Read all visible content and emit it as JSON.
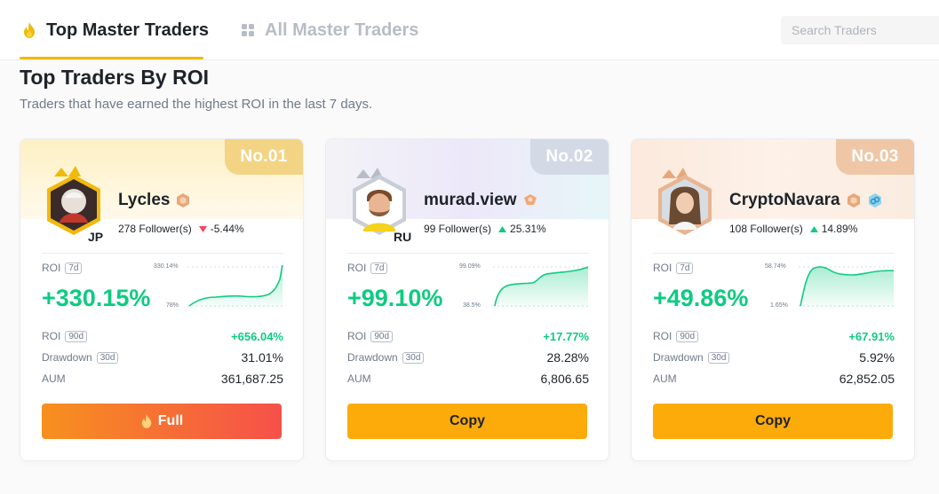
{
  "tabs": [
    {
      "label": "Top Master Traders",
      "icon": "fire-icon",
      "active": true
    },
    {
      "label": "All Master Traders",
      "icon": "grid-icon",
      "active": false
    }
  ],
  "search": {
    "placeholder": "Search Traders"
  },
  "section": {
    "title": "Top Traders By ROI",
    "subtitle": "Traders that have earned the highest ROI in the last 7 days."
  },
  "labels": {
    "roi": "ROI",
    "period_7d": "7d",
    "period_90d": "90d",
    "drawdown": "Drawdown",
    "period_30d": "30d",
    "aum": "AUM"
  },
  "traders": [
    {
      "rank": "No.01",
      "name": "Lycles",
      "country": "JP",
      "followers": "278 Follower(s)",
      "change": "-5.44%",
      "change_dir": "down",
      "roi_7d": "+330.15%",
      "spark_max": "330.14%",
      "spark_min": "78%",
      "roi_90d": "+656.04%",
      "drawdown_30d": "31.01%",
      "aum": "361,687.25",
      "button": "Full",
      "button_icon": "fire-icon",
      "theme_color": "#f0b90b"
    },
    {
      "rank": "No.02",
      "name": "murad.view",
      "country": "RU",
      "followers": "99 Follower(s)",
      "change": "25.31%",
      "change_dir": "up",
      "roi_7d": "+99.10%",
      "spark_max": "99.09%",
      "spark_min": "38.5%",
      "roi_90d": "+17.77%",
      "drawdown_30d": "28.28%",
      "aum": "6,806.65",
      "button": "Copy",
      "theme_color": "#b7bdc6"
    },
    {
      "rank": "No.03",
      "name": "CryptoNavara",
      "country": "",
      "followers": "108 Follower(s)",
      "change": "14.89%",
      "change_dir": "up",
      "roi_7d": "+49.86%",
      "spark_max": "58.74%",
      "spark_min": "1.65%",
      "roi_90d": "+67.91%",
      "drawdown_30d": "5.92%",
      "aum": "62,852.05",
      "button": "Copy",
      "theme_color": "#e2a06f"
    }
  ],
  "colors": {
    "positive": "#0ecb81",
    "negative": "#f6465d",
    "accent": "#f0b90b",
    "copy_button": "#fcab0b"
  }
}
